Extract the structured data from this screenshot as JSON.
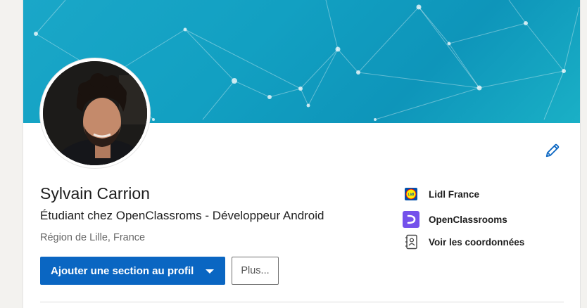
{
  "profile": {
    "name": "Sylvain Carrion",
    "headline": "Étudiant chez OpenClassroms - Développeur Android",
    "location": "Région de Lille, France"
  },
  "actions": {
    "add_section_label": "Ajouter une section au profil",
    "more_label": "Plus..."
  },
  "side_links": [
    {
      "label": "Lidl France",
      "icon": "lidl-logo-icon"
    },
    {
      "label": "OpenClassrooms",
      "icon": "openclassrooms-logo-icon"
    },
    {
      "label": "Voir les coordonnées",
      "icon": "contact-card-icon"
    }
  ],
  "colors": {
    "primary": "#0a66c2",
    "banner": "#12a0c2",
    "openclassrooms": "#7451eb",
    "lidl_blue": "#0050aa",
    "lidl_yellow": "#fff000"
  }
}
